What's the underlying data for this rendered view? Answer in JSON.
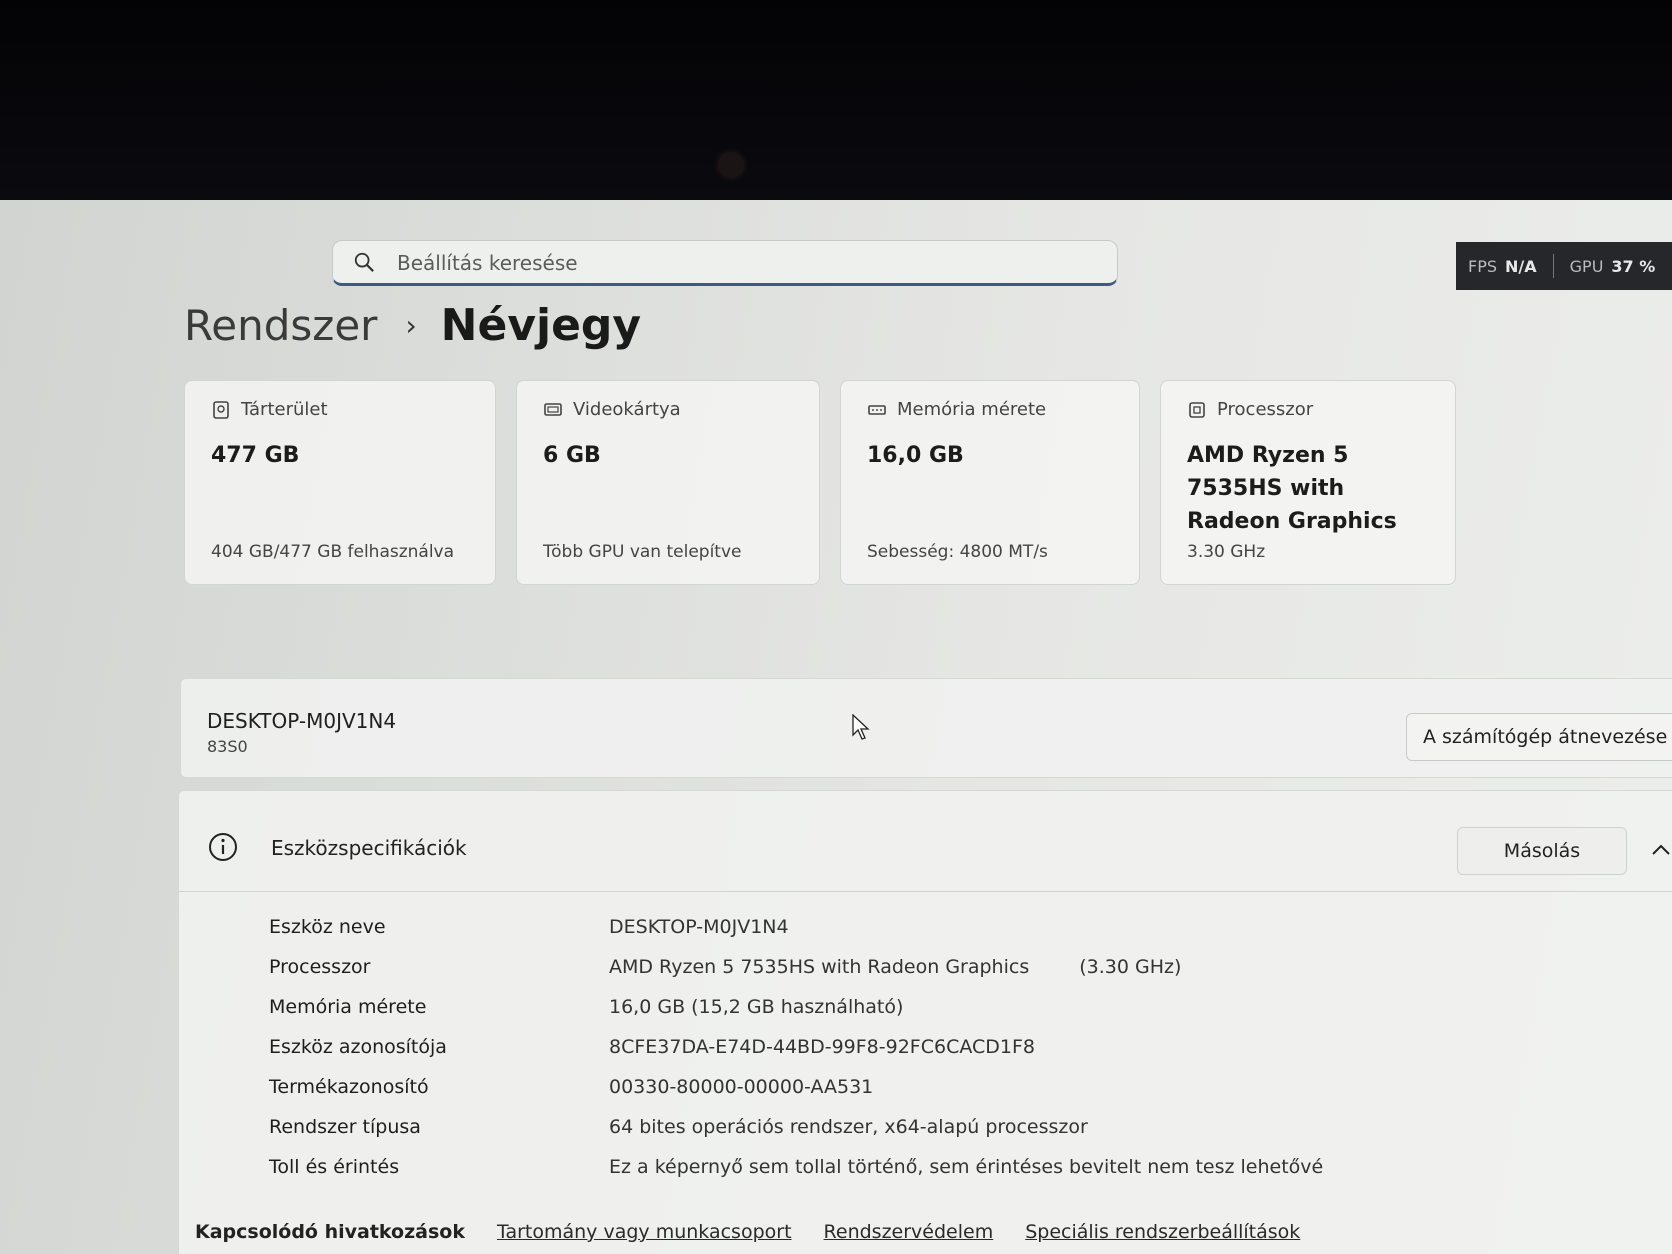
{
  "search": {
    "placeholder": "Beállítás keresése"
  },
  "overlay": {
    "fps_label": "FPS",
    "fps_value": "N/A",
    "gpu_label": "GPU",
    "gpu_value": "37 %"
  },
  "breadcrumb": {
    "parent": "Rendszer",
    "current": "Névjegy"
  },
  "cards": [
    {
      "title": "Tárterület",
      "value": "477 GB",
      "sub": "404 GB/477 GB felhasználva",
      "icon": "storage-icon"
    },
    {
      "title": "Videokártya",
      "value": "6 GB",
      "sub": "Több GPU van telepítve",
      "icon": "gpu-icon"
    },
    {
      "title": "Memória mérete",
      "value": "16,0 GB",
      "sub": "Sebesség: 4800 MT/s",
      "icon": "memory-icon"
    },
    {
      "title": "Processzor",
      "value": "AMD Ryzen 5 7535HS with Radeon Graphics",
      "sub": "3.30 GHz",
      "icon": "cpu-icon"
    }
  ],
  "device": {
    "name": "DESKTOP-M0JV1N4",
    "model": "83S0",
    "rename_label": "A számítógép átnevezése"
  },
  "specs": {
    "title": "Eszközspecifikációk",
    "copy_label": "Másolás",
    "rows": [
      {
        "label": "Eszköz neve",
        "value": "DESKTOP-M0JV1N4"
      },
      {
        "label": "Processzor",
        "value": "AMD Ryzen 5 7535HS with Radeon Graphics",
        "extra": "(3.30 GHz)"
      },
      {
        "label": "Memória mérete",
        "value": "16,0 GB (15,2 GB használható)"
      },
      {
        "label": "Eszköz azonosítója",
        "value": "8CFE37DA-E74D-44BD-99F8-92FC6CACD1F8"
      },
      {
        "label": "Termékazonosító",
        "value": "00330-80000-00000-AA531"
      },
      {
        "label": "Rendszer típusa",
        "value": "64 bites operációs rendszer, x64-alapú processzor"
      },
      {
        "label": "Toll és érintés",
        "value": "Ez a képernyő sem tollal történő, sem érintéses bevitelt nem tesz lehetővé"
      }
    ]
  },
  "related": {
    "label": "Kapcsolódó hivatkozások",
    "links": [
      "Tartomány vagy munkacsoport",
      "Rendszervédelem",
      "Speciális rendszerbeállítások"
    ]
  }
}
